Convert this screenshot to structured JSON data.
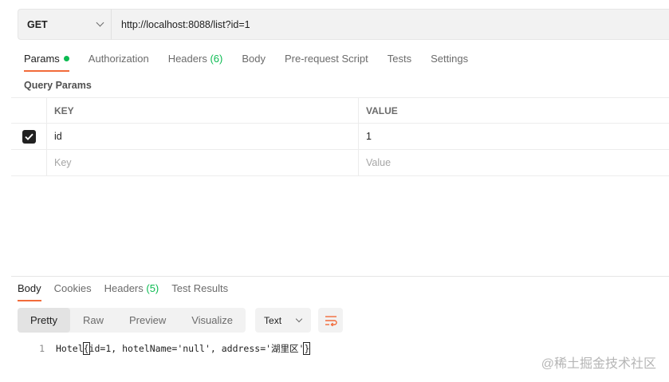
{
  "request": {
    "method": "GET",
    "url": "http://localhost:8088/list?id=1"
  },
  "request_tabs": [
    {
      "label": "Params",
      "count": "",
      "active": true,
      "dot": true
    },
    {
      "label": "Authorization",
      "count": "",
      "active": false
    },
    {
      "label": "Headers",
      "count": "(6)",
      "active": false
    },
    {
      "label": "Body",
      "count": "",
      "active": false
    },
    {
      "label": "Pre-request Script",
      "count": "",
      "active": false
    },
    {
      "label": "Tests",
      "count": "",
      "active": false
    },
    {
      "label": "Settings",
      "count": "",
      "active": false
    }
  ],
  "query_params": {
    "title": "Query Params",
    "columns": {
      "key": "KEY",
      "value": "VALUE"
    },
    "rows": [
      {
        "checked": true,
        "key": "id",
        "value": "1"
      }
    ],
    "new_row": {
      "key_placeholder": "Key",
      "value_placeholder": "Value"
    }
  },
  "response_tabs": [
    {
      "label": "Body",
      "count": "",
      "active": true
    },
    {
      "label": "Cookies",
      "count": "",
      "active": false
    },
    {
      "label": "Headers",
      "count": "(5)",
      "active": false
    },
    {
      "label": "Test Results",
      "count": "",
      "active": false
    }
  ],
  "view_modes": [
    "Pretty",
    "Raw",
    "Preview",
    "Visualize"
  ],
  "active_view_mode": "Pretty",
  "format": "Text",
  "response_body": {
    "line_number": "1",
    "prefix": "Hotel",
    "brace": "{",
    "content": "id=1, hotelName='null', address='湖里区'",
    "close": "}"
  },
  "watermark": "@稀土掘金技术社区",
  "colors": {
    "accent": "#f26b3a",
    "success": "#0cbb52"
  }
}
